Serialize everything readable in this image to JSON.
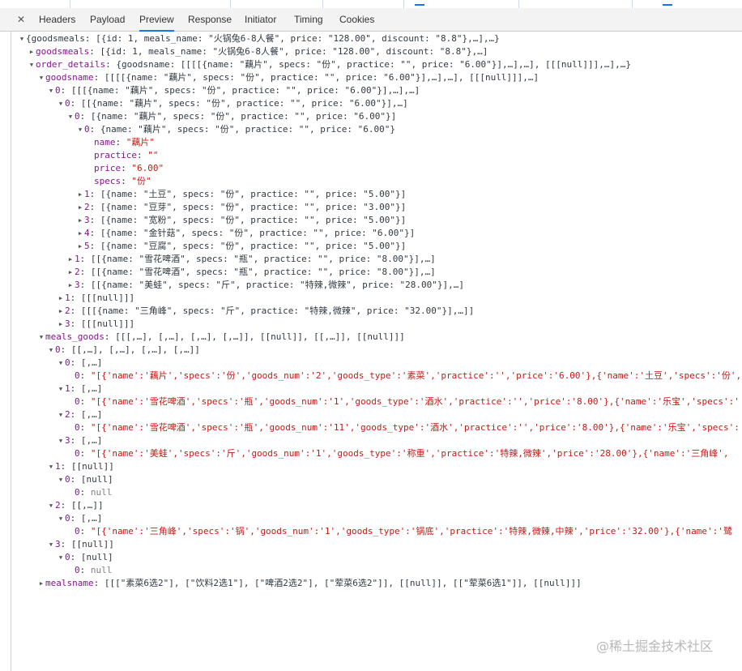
{
  "tabs": [
    "Headers",
    "Payload",
    "Preview",
    "Response",
    "Initiator",
    "Timing",
    "Cookies"
  ],
  "active_tab": "Preview",
  "tree": [
    {
      "d": 0,
      "a": "d",
      "t": [
        [
          "k0",
          "{goodsmeals: [{id: 1, meals_name: \"火锅兔6-8人餐\", price: \"128.00\", discount: \"8.8\"},…],…}"
        ]
      ]
    },
    {
      "d": 1,
      "a": "r",
      "t": [
        [
          "k",
          "goodsmeals"
        ],
        [
          "k0",
          ": [{id: 1, meals_name: \"火锅兔6-8人餐\", price: \"128.00\", discount: \"8.8\"},…]"
        ]
      ]
    },
    {
      "d": 1,
      "a": "d",
      "t": [
        [
          "k",
          "order_details"
        ],
        [
          "k0",
          ": {goodsname: [[[[{name: \"藕片\", specs: \"份\", practice: \"\", price: \"6.00\"}],…],…], [[[null]]],…],…}"
        ]
      ]
    },
    {
      "d": 2,
      "a": "d",
      "t": [
        [
          "k",
          "goodsname"
        ],
        [
          "k0",
          ": [[[[{name: \"藕片\", specs: \"份\", practice: \"\", price: \"6.00\"}],…],…], [[[null]]],…]"
        ]
      ]
    },
    {
      "d": 3,
      "a": "d",
      "t": [
        [
          "k",
          "0"
        ],
        [
          "k0",
          ": [[[{name: \"藕片\", specs: \"份\", practice: \"\", price: \"6.00\"}],…],…]"
        ]
      ]
    },
    {
      "d": 4,
      "a": "d",
      "t": [
        [
          "k",
          "0"
        ],
        [
          "k0",
          ": [[{name: \"藕片\", specs: \"份\", practice: \"\", price: \"6.00\"}],…]"
        ]
      ]
    },
    {
      "d": 5,
      "a": "d",
      "t": [
        [
          "k",
          "0"
        ],
        [
          "k0",
          ": [{name: \"藕片\", specs: \"份\", practice: \"\", price: \"6.00\"}]"
        ]
      ]
    },
    {
      "d": 6,
      "a": "d",
      "t": [
        [
          "k",
          "0"
        ],
        [
          "k0",
          ": {name: \"藕片\", specs: \"份\", practice: \"\", price: \"6.00\"}"
        ]
      ]
    },
    {
      "d": 7,
      "a": "n",
      "t": [
        [
          "k",
          "name"
        ],
        [
          "k0",
          ": "
        ],
        [
          "s",
          "\"藕片\""
        ]
      ]
    },
    {
      "d": 7,
      "a": "n",
      "t": [
        [
          "k",
          "practice"
        ],
        [
          "k0",
          ": "
        ],
        [
          "s",
          "\"\""
        ]
      ]
    },
    {
      "d": 7,
      "a": "n",
      "t": [
        [
          "k",
          "price"
        ],
        [
          "k0",
          ": "
        ],
        [
          "s",
          "\"6.00\""
        ]
      ]
    },
    {
      "d": 7,
      "a": "n",
      "t": [
        [
          "k",
          "specs"
        ],
        [
          "k0",
          ": "
        ],
        [
          "s",
          "\"份\""
        ]
      ]
    },
    {
      "d": 6,
      "a": "r",
      "t": [
        [
          "k",
          "1"
        ],
        [
          "k0",
          ": [{name: \"土豆\", specs: \"份\", practice: \"\", price: \"5.00\"}]"
        ]
      ]
    },
    {
      "d": 6,
      "a": "r",
      "t": [
        [
          "k",
          "2"
        ],
        [
          "k0",
          ": [{name: \"豆芽\", specs: \"份\", practice: \"\", price: \"3.00\"}]"
        ]
      ]
    },
    {
      "d": 6,
      "a": "r",
      "t": [
        [
          "k",
          "3"
        ],
        [
          "k0",
          ": [{name: \"宽粉\", specs: \"份\", practice: \"\", price: \"5.00\"}]"
        ]
      ]
    },
    {
      "d": 6,
      "a": "r",
      "t": [
        [
          "k",
          "4"
        ],
        [
          "k0",
          ": [{name: \"金针菇\", specs: \"份\", practice: \"\", price: \"6.00\"}]"
        ]
      ]
    },
    {
      "d": 6,
      "a": "r",
      "t": [
        [
          "k",
          "5"
        ],
        [
          "k0",
          ": [{name: \"豆腐\", specs: \"份\", practice: \"\", price: \"5.00\"}]"
        ]
      ]
    },
    {
      "d": 5,
      "a": "r",
      "t": [
        [
          "k",
          "1"
        ],
        [
          "k0",
          ": [[{name: \"雪花啤酒\", specs: \"瓶\", practice: \"\", price: \"8.00\"}],…]"
        ]
      ]
    },
    {
      "d": 5,
      "a": "r",
      "t": [
        [
          "k",
          "2"
        ],
        [
          "k0",
          ": [[{name: \"雪花啤酒\", specs: \"瓶\", practice: \"\", price: \"8.00\"}],…]"
        ]
      ]
    },
    {
      "d": 5,
      "a": "r",
      "t": [
        [
          "k",
          "3"
        ],
        [
          "k0",
          ": [[{name: \"美蛙\", specs: \"斤\", practice: \"特辣,微辣\", price: \"28.00\"}],…]"
        ]
      ]
    },
    {
      "d": 4,
      "a": "r",
      "t": [
        [
          "k",
          "1"
        ],
        [
          "k0",
          ": [[[null]]]"
        ]
      ]
    },
    {
      "d": 4,
      "a": "r",
      "t": [
        [
          "k",
          "2"
        ],
        [
          "k0",
          ": [[[{name: \"三角峰\", specs: \"斤\", practice: \"特辣,微辣\", price: \"32.00\"}],…]]"
        ]
      ]
    },
    {
      "d": 4,
      "a": "r",
      "t": [
        [
          "k",
          "3"
        ],
        [
          "k0",
          ": [[[null]]]"
        ]
      ]
    },
    {
      "d": 2,
      "a": "d",
      "t": [
        [
          "k",
          "meals_goods"
        ],
        [
          "k0",
          ": [[[,…], [,…], [,…], [,…]], [[null]], [[,…]], [[null]]]"
        ]
      ]
    },
    {
      "d": 3,
      "a": "d",
      "t": [
        [
          "k",
          "0"
        ],
        [
          "k0",
          ": [[,…], [,…], [,…], [,…]]"
        ]
      ]
    },
    {
      "d": 4,
      "a": "d",
      "t": [
        [
          "k",
          "0"
        ],
        [
          "k0",
          ": [,…]"
        ]
      ]
    },
    {
      "d": 5,
      "a": "n",
      "t": [
        [
          "k",
          "0"
        ],
        [
          "k0",
          ": "
        ],
        [
          "s",
          "\"[{'name':'藕片','specs':'份','goods_num':'2','goods_type':'素菜','practice':'','price':'6.00'},{'name':'土豆','specs':'份',"
        ]
      ]
    },
    {
      "d": 4,
      "a": "d",
      "t": [
        [
          "k",
          "1"
        ],
        [
          "k0",
          ": [,…]"
        ]
      ]
    },
    {
      "d": 5,
      "a": "n",
      "t": [
        [
          "k",
          "0"
        ],
        [
          "k0",
          ": "
        ],
        [
          "s",
          "\"[{'name':'雪花啤酒','specs':'瓶','goods_num':'1','goods_type':'酒水','practice':'','price':'8.00'},{'name':'乐宝','specs':'"
        ]
      ]
    },
    {
      "d": 4,
      "a": "d",
      "t": [
        [
          "k",
          "2"
        ],
        [
          "k0",
          ": [,…]"
        ]
      ]
    },
    {
      "d": 5,
      "a": "n",
      "t": [
        [
          "k",
          "0"
        ],
        [
          "k0",
          ": "
        ],
        [
          "s",
          "\"[{'name':'雪花啤酒','specs':'瓶','goods_num':'11','goods_type':'酒水','practice':'','price':'8.00'},{'name':'乐宝','specs':"
        ]
      ]
    },
    {
      "d": 4,
      "a": "d",
      "t": [
        [
          "k",
          "3"
        ],
        [
          "k0",
          ": [,…]"
        ]
      ]
    },
    {
      "d": 5,
      "a": "n",
      "t": [
        [
          "k",
          "0"
        ],
        [
          "k0",
          ": "
        ],
        [
          "s",
          "\"[{'name':'美蛙','specs':'斤','goods_num':'1','goods_type':'称重','practice':'特辣,微辣','price':'28.00'},{'name':'三角峰',"
        ]
      ]
    },
    {
      "d": 3,
      "a": "d",
      "t": [
        [
          "k",
          "1"
        ],
        [
          "k0",
          ": [[null]]"
        ]
      ]
    },
    {
      "d": 4,
      "a": "d",
      "t": [
        [
          "k",
          "0"
        ],
        [
          "k0",
          ": [null]"
        ]
      ]
    },
    {
      "d": 5,
      "a": "n",
      "t": [
        [
          "k",
          "0"
        ],
        [
          "k0",
          ": "
        ],
        [
          "nl",
          "null"
        ]
      ]
    },
    {
      "d": 3,
      "a": "d",
      "t": [
        [
          "k",
          "2"
        ],
        [
          "k0",
          ": [[,…]]"
        ]
      ]
    },
    {
      "d": 4,
      "a": "d",
      "t": [
        [
          "k",
          "0"
        ],
        [
          "k0",
          ": [,…]"
        ]
      ]
    },
    {
      "d": 5,
      "a": "n",
      "t": [
        [
          "k",
          "0"
        ],
        [
          "k0",
          ": "
        ],
        [
          "s",
          "\"[{'name':'三角峰','specs':'锅','goods_num':'1','goods_type':'锅底','practice':'特辣,微辣,中辣','price':'32.00'},{'name':'鹭"
        ]
      ]
    },
    {
      "d": 3,
      "a": "d",
      "t": [
        [
          "k",
          "3"
        ],
        [
          "k0",
          ": [[null]]"
        ]
      ]
    },
    {
      "d": 4,
      "a": "d",
      "t": [
        [
          "k",
          "0"
        ],
        [
          "k0",
          ": [null]"
        ]
      ]
    },
    {
      "d": 5,
      "a": "n",
      "t": [
        [
          "k",
          "0"
        ],
        [
          "k0",
          ": "
        ],
        [
          "nl",
          "null"
        ]
      ]
    },
    {
      "d": 2,
      "a": "r",
      "t": [
        [
          "k",
          "mealsname"
        ],
        [
          "k0",
          ": [[[\"素菜6选2\"], [\"饮料2选1\"], [\"啤酒2选2\"], [\"荤菜6选2\"]], [[null]], [[\"荤菜6选1\"]], [[null]]]"
        ]
      ]
    }
  ],
  "watermark": "@稀土掘金技术社区"
}
